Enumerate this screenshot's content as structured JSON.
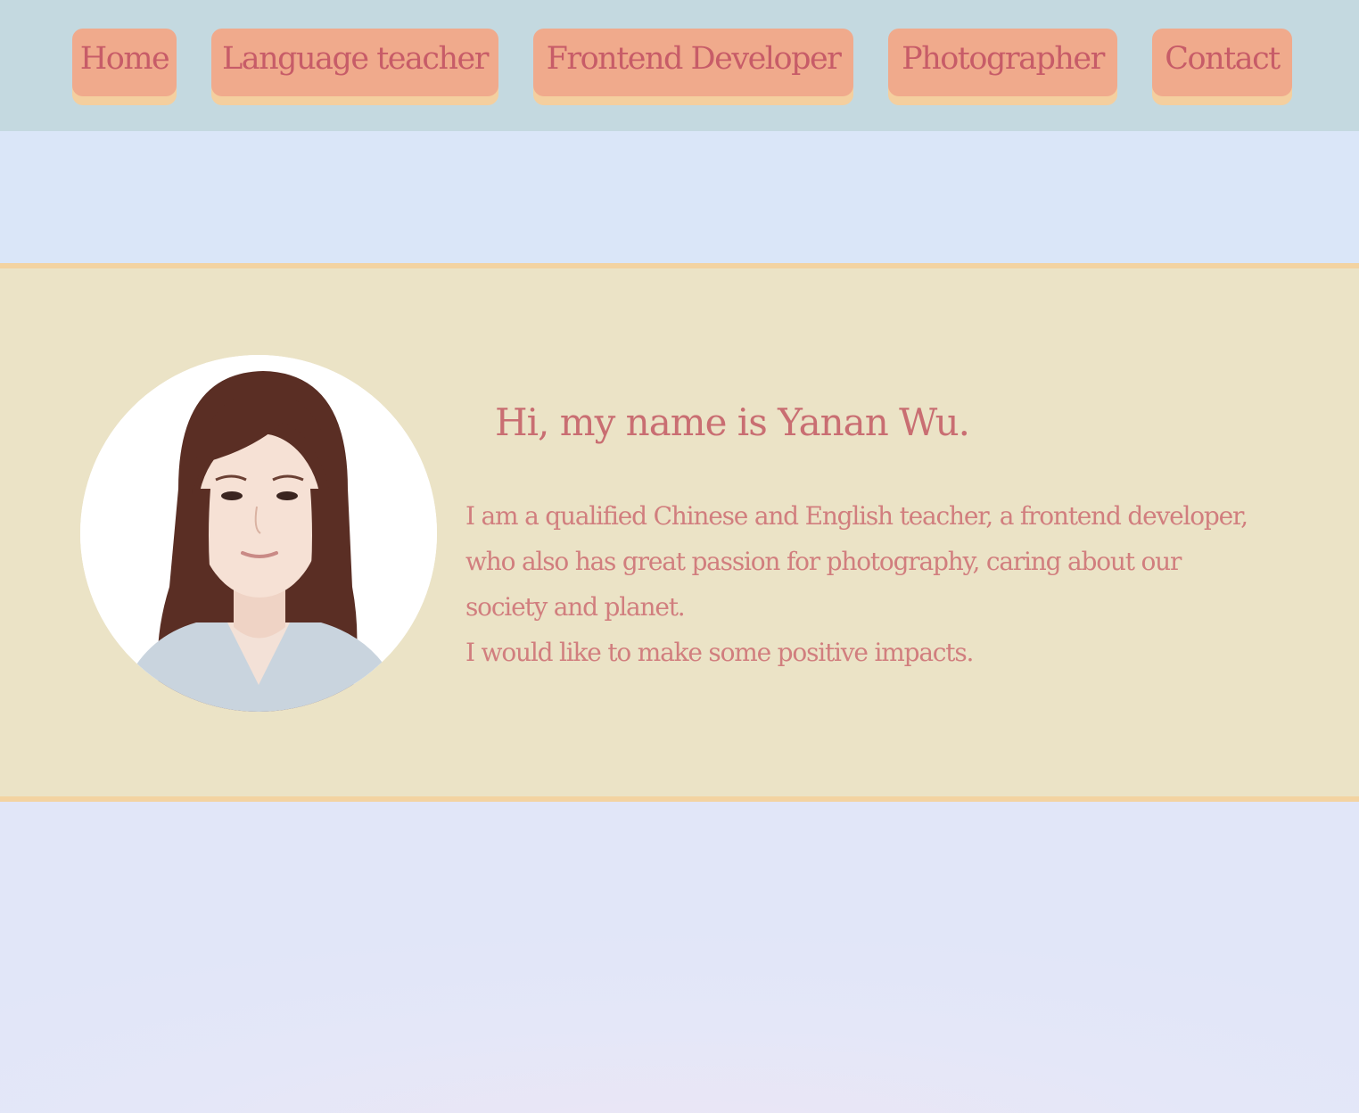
{
  "nav": {
    "items": [
      {
        "label": "Home"
      },
      {
        "label": "Language teacher"
      },
      {
        "label": "Frontend Developer"
      },
      {
        "label": "Photographer"
      },
      {
        "label": "Contact"
      }
    ]
  },
  "intro": {
    "greeting": "Hi, my name is Yanan Wu.",
    "bio_lines": [
      "I am a qualified Chinese and English teacher, a frontend developer, who also has great passion for photography, caring about our society and planet.",
      "I would like to make some positive impacts."
    ]
  },
  "colors": {
    "nav_bg": "#c4d9e0",
    "button_bg": "#f0aa8c",
    "button_shadow": "#f4cf9f",
    "text_accent": "#c96e72",
    "intro_bg": "#ebe3c6",
    "border": "#f3d3a1"
  }
}
